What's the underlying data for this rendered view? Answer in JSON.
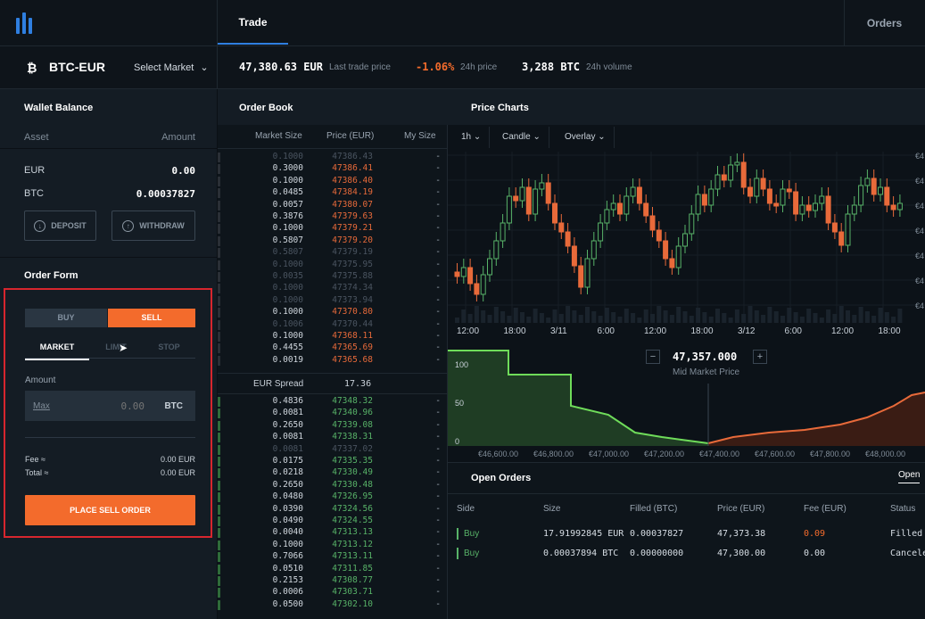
{
  "nav": {
    "trade_tab": "Trade",
    "orders_link": "Orders"
  },
  "ticker": {
    "pair": "BTC-EUR",
    "select_market": "Select Market",
    "last_price": "47,380.63",
    "last_price_unit": "EUR",
    "last_price_label": "Last trade price",
    "change": "-1.06%",
    "change_label": "24h price",
    "volume": "3,288",
    "volume_unit": "BTC",
    "volume_label": "24h volume",
    "colors": {
      "negative": "#f36b2c",
      "positive": "#58b368",
      "accent": "#2f7fe0"
    }
  },
  "wallet": {
    "title": "Wallet Balance",
    "asset_header": "Asset",
    "amount_header": "Amount",
    "rows": [
      {
        "asset": "EUR",
        "amount": "0.00"
      },
      {
        "asset": "BTC",
        "amount": "0.00037827"
      }
    ],
    "deposit": "DEPOSIT",
    "withdraw": "WITHDRAW"
  },
  "order_form": {
    "title": "Order Form",
    "buy": "BUY",
    "sell": "SELL",
    "tabs": [
      "MARKET",
      "LIMIT",
      "STOP"
    ],
    "amount_label": "Amount",
    "max_label": "Max",
    "amount_placeholder": "0.00",
    "amount_unit": "BTC",
    "fee_label": "Fee ≈",
    "fee_value": "0.00 EUR",
    "total_label": "Total ≈",
    "total_value": "0.00 EUR",
    "place_order": "PLACE SELL ORDER"
  },
  "order_book": {
    "title": "Order Book",
    "headers": [
      "Market Size",
      "Price (EUR)",
      "My Size"
    ],
    "asks": [
      {
        "size": "0.1000",
        "price": "47386.43",
        "mine": "-",
        "dim": true
      },
      {
        "size": "0.3000",
        "price": "47386.41",
        "mine": "-"
      },
      {
        "size": "0.1000",
        "price": "47386.40",
        "mine": "-"
      },
      {
        "size": "0.0485",
        "price": "47384.19",
        "mine": "-"
      },
      {
        "size": "0.0057",
        "price": "47380.07",
        "mine": "-"
      },
      {
        "size": "0.3876",
        "price": "47379.63",
        "mine": "-"
      },
      {
        "size": "0.1000",
        "price": "47379.21",
        "mine": "-"
      },
      {
        "size": "0.5807",
        "price": "47379.20",
        "mine": "-"
      },
      {
        "size": "0.5807",
        "price": "47379.19",
        "mine": "-",
        "dim": true
      },
      {
        "size": "0.1000",
        "price": "47375.95",
        "mine": "-",
        "dim": true
      },
      {
        "size": "0.0035",
        "price": "47375.88",
        "mine": "-",
        "dim": true
      },
      {
        "size": "0.1000",
        "price": "47374.34",
        "mine": "-",
        "dim": true
      },
      {
        "size": "0.1000",
        "price": "47373.94",
        "mine": "-",
        "dim": true
      },
      {
        "size": "0.1000",
        "price": "47370.80",
        "mine": "-"
      },
      {
        "size": "0.1006",
        "price": "47370.44",
        "mine": "-",
        "dim": true
      },
      {
        "size": "0.1000",
        "price": "47368.11",
        "mine": "-"
      },
      {
        "size": "0.4455",
        "price": "47365.69",
        "mine": "-"
      },
      {
        "size": "0.0019",
        "price": "47365.68",
        "mine": "-"
      }
    ],
    "spread_label": "EUR Spread",
    "spread_value": "17.36",
    "bids": [
      {
        "size": "0.4836",
        "price": "47348.32",
        "mine": "-"
      },
      {
        "size": "0.0081",
        "price": "47340.96",
        "mine": "-"
      },
      {
        "size": "0.2650",
        "price": "47339.08",
        "mine": "-"
      },
      {
        "size": "0.0081",
        "price": "47338.31",
        "mine": "-"
      },
      {
        "size": "0.0081",
        "price": "47337.02",
        "mine": "-",
        "dim": true
      },
      {
        "size": "0.0175",
        "price": "47335.35",
        "mine": "-"
      },
      {
        "size": "0.0218",
        "price": "47330.49",
        "mine": "-"
      },
      {
        "size": "0.2650",
        "price": "47330.48",
        "mine": "-"
      },
      {
        "size": "0.0480",
        "price": "47326.95",
        "mine": "-"
      },
      {
        "size": "0.0390",
        "price": "47324.56",
        "mine": "-"
      },
      {
        "size": "0.0490",
        "price": "47324.55",
        "mine": "-"
      },
      {
        "size": "0.0040",
        "price": "47313.13",
        "mine": "-"
      },
      {
        "size": "0.1000",
        "price": "47313.12",
        "mine": "-"
      },
      {
        "size": "0.7066",
        "price": "47313.11",
        "mine": "-"
      },
      {
        "size": "0.0510",
        "price": "47311.85",
        "mine": "-"
      },
      {
        "size": "0.2153",
        "price": "47308.77",
        "mine": "-"
      },
      {
        "size": "0.0006",
        "price": "47303.71",
        "mine": "-"
      },
      {
        "size": "0.0500",
        "price": "47302.10",
        "mine": "-"
      }
    ]
  },
  "price_charts": {
    "title": "Price Charts",
    "controls": [
      "1h",
      "Candle",
      "Overlay"
    ],
    "time_labels": [
      "12:00",
      "18:00",
      "3/11",
      "6:00",
      "12:00",
      "18:00",
      "3/12",
      "6:00",
      "12:00",
      "18:00"
    ],
    "mid_price": "47,357.000",
    "mid_label": "Mid Market Price",
    "minus": "−",
    "plus": "+",
    "depth_y_labels": [
      "100",
      "50",
      "0"
    ],
    "depth_x_labels": [
      "€46,600.00",
      "€46,800.00",
      "€47,000.00",
      "€47,200.00",
      "€47,400.00",
      "€47,600.00",
      "€47,800.00",
      "€48,000.00"
    ],
    "right_axis_glyph": "€4"
  },
  "open_orders": {
    "title": "Open Orders",
    "toggle": "Open",
    "headers": [
      "Side",
      "Size",
      "Filled (BTC)",
      "Price (EUR)",
      "Fee (EUR)",
      "Status"
    ],
    "rows": [
      {
        "side": "Buy",
        "size": "17.91992845 EUR",
        "filled": "0.00037827",
        "price": "47,373.38",
        "fee": "0.09",
        "status": "Filled"
      },
      {
        "side": "Buy",
        "size": "0.00037894 BTC",
        "filled": "0.00000000",
        "price": "47,300.00",
        "fee": "0.00",
        "status": "Cancele"
      }
    ]
  }
}
